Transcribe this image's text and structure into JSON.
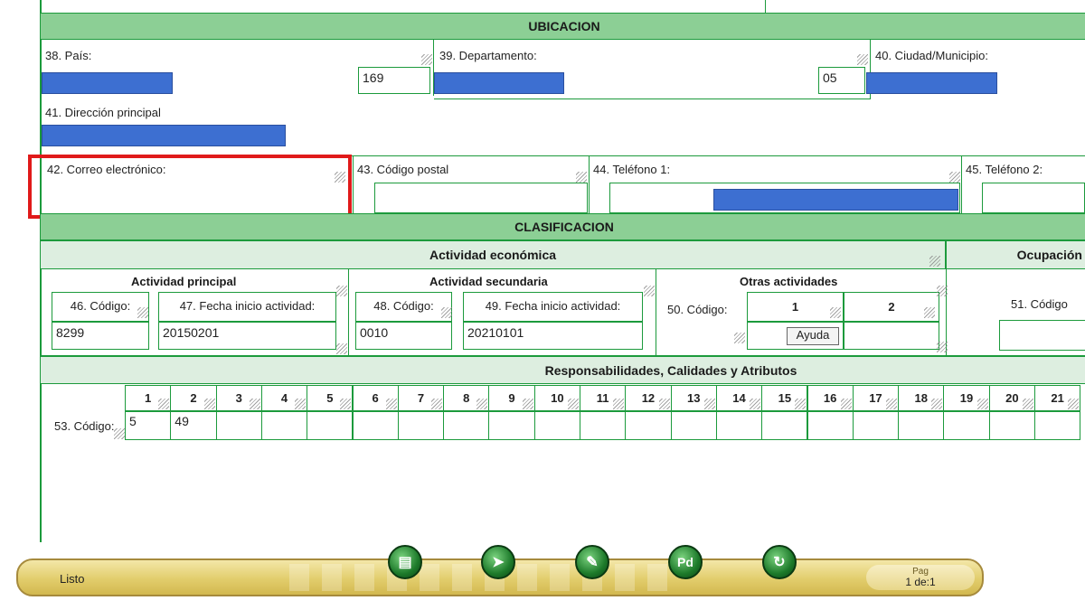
{
  "ubicacion": {
    "title": "UBICACION",
    "pais_label": "38. País:",
    "pais_code": "169",
    "departamento_label": "39. Departamento:",
    "departamento_code": "05",
    "ciudad_label": "40. Ciudad/Municipio:",
    "direccion_label": "41. Dirección principal",
    "correo_label": "42. Correo electrónico:",
    "postal_label": "43. Código postal",
    "telefono1_label": "44. Teléfono 1:",
    "telefono2_label": "45. Teléfono 2:"
  },
  "clasificacion": {
    "title": "CLASIFICACION",
    "actividad_economica": "Actividad económica",
    "ocupacion": "Ocupación",
    "principal": {
      "title": "Actividad principal",
      "codigo_label": "46. Código:",
      "codigo_value": "8299",
      "fecha_label": "47. Fecha inicio actividad:",
      "fecha_value": "20150201"
    },
    "secundaria": {
      "title": "Actividad secundaria",
      "codigo_label": "48. Código:",
      "codigo_value": "0010",
      "fecha_label": "49. Fecha inicio actividad:",
      "fecha_value": "20210101"
    },
    "otras": {
      "title": "Otras actividades",
      "codigo_label": "50. Código:",
      "col1": "1",
      "col2": "2",
      "ayuda": "Ayuda"
    },
    "ocupacion_codigo_label": "51. Código"
  },
  "responsabilidades": {
    "title": "Responsabilidades, Calidades y Atributos",
    "codigo_label": "53. Código:",
    "columns": [
      "1",
      "2",
      "3",
      "4",
      "5",
      "6",
      "7",
      "8",
      "9",
      "10",
      "11",
      "12",
      "13",
      "14",
      "15",
      "16",
      "17",
      "18",
      "19",
      "20",
      "21"
    ],
    "values": [
      "5",
      "49"
    ]
  },
  "statusbar": {
    "status": "Listo",
    "page_label": "Pag",
    "page_value": "1 de:1"
  },
  "colors": {
    "section_header": "#8ccf95",
    "border_green": "#1c9a3c",
    "redaction_blue": "#3d6fd1",
    "highlight_red": "#e01a1a"
  }
}
